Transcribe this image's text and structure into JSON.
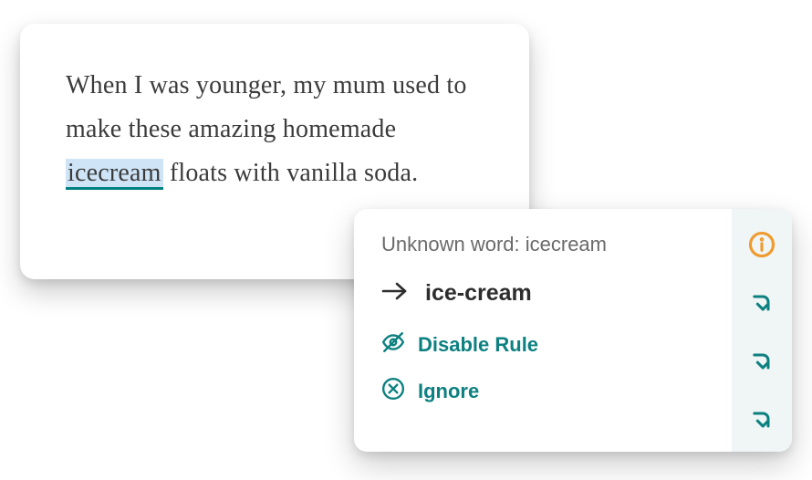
{
  "text": {
    "before": "When I was younger, my mum used to make these amazing homemade ",
    "error_word": "icecream",
    "after": " floats with vanilla soda."
  },
  "popup": {
    "header_prefix": "Unknown word: ",
    "header_word": "icecream",
    "suggestion": "ice-cream",
    "disable_label": "Disable Rule",
    "ignore_label": "Ignore"
  }
}
